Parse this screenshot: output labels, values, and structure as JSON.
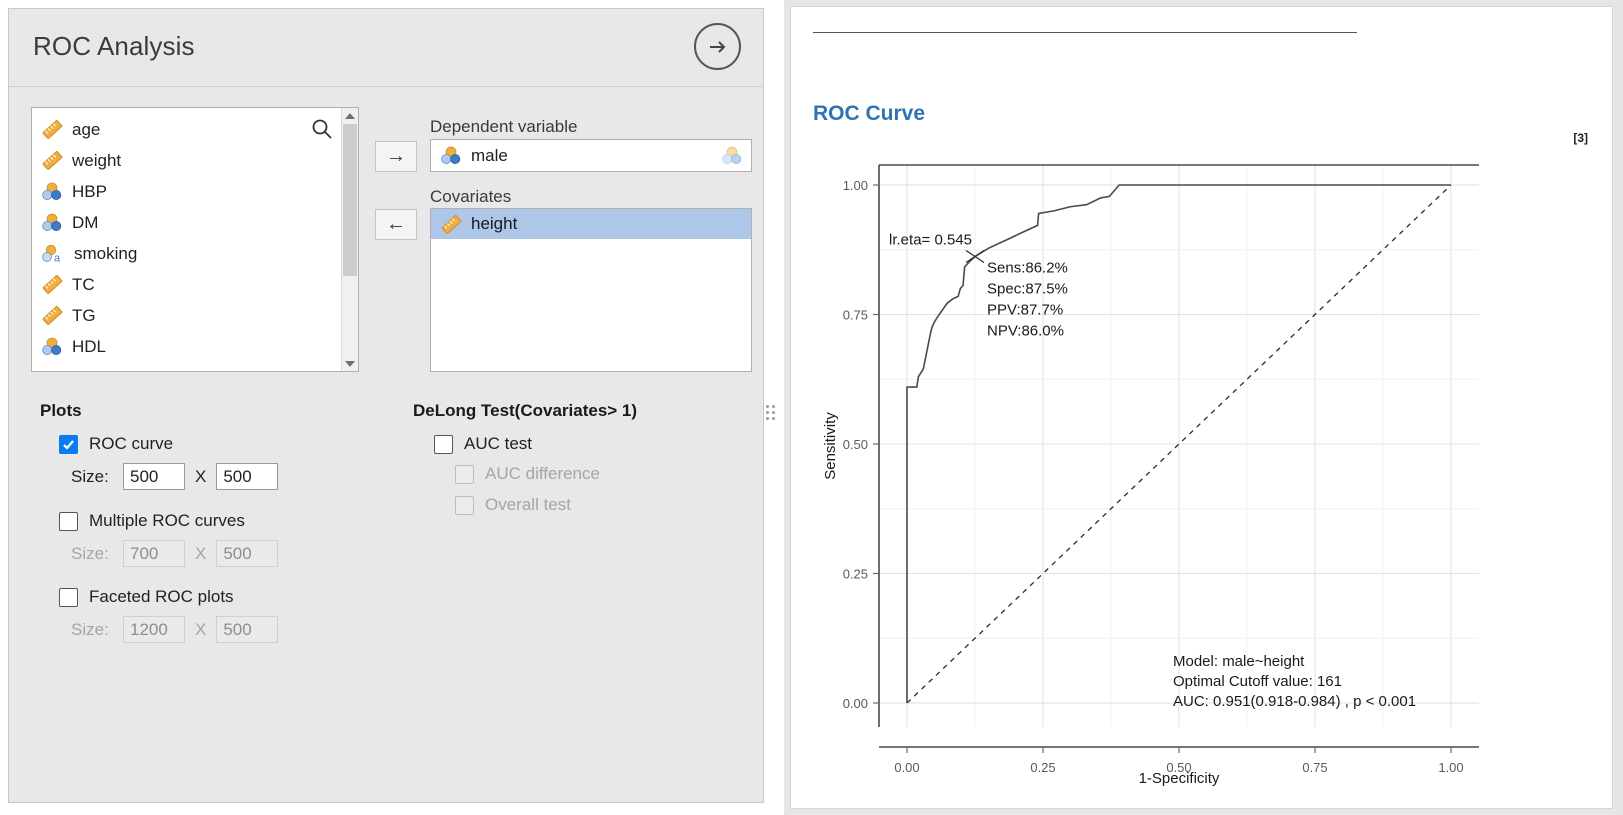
{
  "dialog": {
    "title": "ROC Analysis",
    "run_button": "run-arrow",
    "variables": [
      {
        "name": "age",
        "icon": "ruler-icon"
      },
      {
        "name": "weight",
        "icon": "ruler-icon"
      },
      {
        "name": "HBP",
        "icon": "nominal-icon"
      },
      {
        "name": "DM",
        "icon": "nominal-icon"
      },
      {
        "name": "smoking",
        "icon": "text-nominal-icon"
      },
      {
        "name": "TC",
        "icon": "ruler-icon"
      },
      {
        "name": "TG",
        "icon": "ruler-icon"
      },
      {
        "name": "HDL",
        "icon": "nominal-icon"
      }
    ],
    "move_right_label": "→",
    "move_left_label": "←",
    "dependent": {
      "label": "Dependent variable",
      "value": "male",
      "icon": "nominal-icon"
    },
    "covariates": {
      "label": "Covariates",
      "items": [
        {
          "name": "height",
          "icon": "ruler-icon",
          "selected": true
        }
      ]
    },
    "plots": {
      "title": "Plots",
      "roc_curve": {
        "label": "ROC curve",
        "checked": true,
        "size_label": "Size:",
        "width": "500",
        "x_label": "X",
        "height": "500"
      },
      "multiple_roc": {
        "label": "Multiple ROC curves",
        "checked": false,
        "size_label": "Size:",
        "width": "700",
        "x_label": "X",
        "height": "500"
      },
      "faceted_roc": {
        "label": "Faceted ROC plots",
        "checked": false,
        "size_label": "Size:",
        "width": "1200",
        "x_label": "X",
        "height": "500"
      }
    },
    "delong": {
      "title": "DeLong Test(Covariates> 1)",
      "auc_test": {
        "label": "AUC test",
        "checked": false,
        "enabled": true
      },
      "auc_difference": {
        "label": "AUC difference",
        "checked": false,
        "enabled": false
      },
      "overall_test": {
        "label": "Overall test",
        "checked": false,
        "enabled": false
      }
    }
  },
  "output": {
    "heading": "ROC Curve",
    "index_marker": "[3]"
  },
  "chart_data": {
    "type": "line",
    "title": "ROC Curve",
    "xlabel": "1-Specificity",
    "ylabel": "Sensitivity",
    "xlim": [
      0,
      1
    ],
    "ylim": [
      0,
      1
    ],
    "xticks": [
      "0.00",
      "0.25",
      "0.50",
      "0.75",
      "1.00"
    ],
    "yticks": [
      "0.00",
      "0.25",
      "0.50",
      "0.75",
      "1.00"
    ],
    "grid": true,
    "legend": "none",
    "series": [
      {
        "name": "ROC curve (male~height)",
        "style": "solid",
        "points": [
          [
            0.0,
            0.0
          ],
          [
            0.0,
            0.61
          ],
          [
            0.018,
            0.61
          ],
          [
            0.021,
            0.63
          ],
          [
            0.03,
            0.645
          ],
          [
            0.044,
            0.718
          ],
          [
            0.046,
            0.725
          ],
          [
            0.05,
            0.735
          ],
          [
            0.056,
            0.745
          ],
          [
            0.074,
            0.772
          ],
          [
            0.084,
            0.78
          ],
          [
            0.094,
            0.785
          ],
          [
            0.098,
            0.8
          ],
          [
            0.103,
            0.806
          ],
          [
            0.106,
            0.842
          ],
          [
            0.113,
            0.85
          ],
          [
            0.125,
            0.862
          ],
          [
            0.15,
            0.878
          ],
          [
            0.185,
            0.895
          ],
          [
            0.215,
            0.91
          ],
          [
            0.24,
            0.922
          ],
          [
            0.242,
            0.945
          ],
          [
            0.27,
            0.95
          ],
          [
            0.3,
            0.958
          ],
          [
            0.33,
            0.962
          ],
          [
            0.356,
            0.975
          ],
          [
            0.372,
            0.978
          ],
          [
            0.39,
            1.0
          ],
          [
            1.0,
            1.0
          ]
        ]
      },
      {
        "name": "Reference diagonal",
        "style": "dashed",
        "points": [
          [
            0.0,
            0.0
          ],
          [
            1.0,
            1.0
          ]
        ]
      }
    ],
    "annotations": {
      "cutoff_label": "lr.eta= 0.545",
      "cutoff_point": [
        0.125,
        0.862
      ],
      "metrics": [
        "Sens:86.2%",
        "Spec:87.5%",
        "PPV:87.7%",
        "NPV:86.0%"
      ],
      "model_line": "Model: male~height",
      "cutoff_line": "Optimal Cutoff value:  161",
      "auc_line": "AUC:  0.951(0.918-0.984) , p < 0.001"
    }
  }
}
